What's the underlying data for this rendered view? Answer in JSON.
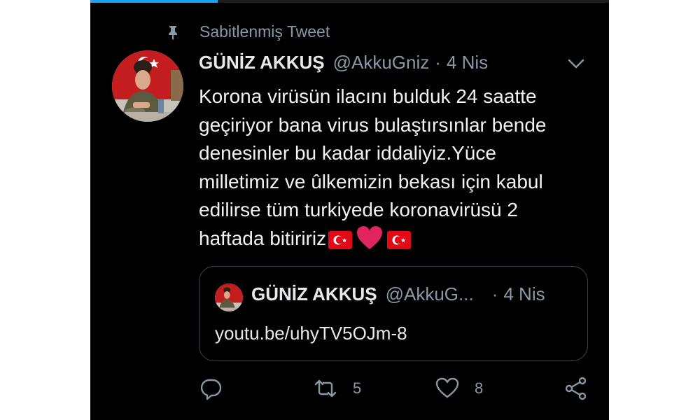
{
  "colors": {
    "background": "#000000",
    "text": "#f2f2f2",
    "secondary": "#8899a6",
    "accent": "#1da1f2",
    "heart": "#e0245e",
    "flag": "#e30a17",
    "border": "#38444d"
  },
  "progress": {
    "fraction": 0.245
  },
  "pinned": {
    "icon": "pin-icon",
    "label": "Sabitlenmiş Tweet"
  },
  "tweet": {
    "author_name": "GÜNİZ AKKUŞ",
    "handle": "@AkkuGniz",
    "separator": "·",
    "date": "4 Nis",
    "menu_icon": "chevron-down-icon",
    "text_lines": [
      "Korona virüsün ilacını bulduk 24 saatte",
      "geçiriyor bana virus bulaştırsınlar bende",
      "denesinler bu kadar iddaliyiz.Yüce",
      "milletimiz ve ûlkemizin bekası için kabul",
      "edilirse tüm turkiyede koronavirüsü 2",
      "haftada bitiririz"
    ],
    "emojis": [
      "turkey-flag-emoji",
      "red-heart-emoji",
      "turkey-flag-emoji"
    ]
  },
  "quote": {
    "author_name": "GÜNİZ AKKUŞ",
    "handle": "@AkkuG...",
    "separator": "·",
    "date": "4 Nis",
    "link": "youtu.be/uhyTV5OJm-8"
  },
  "actions": {
    "reply": {
      "icon": "reply-icon"
    },
    "retweet": {
      "icon": "retweet-icon",
      "count": "5"
    },
    "like": {
      "icon": "heart-icon",
      "count": "8"
    },
    "share": {
      "icon": "share-icon"
    }
  }
}
